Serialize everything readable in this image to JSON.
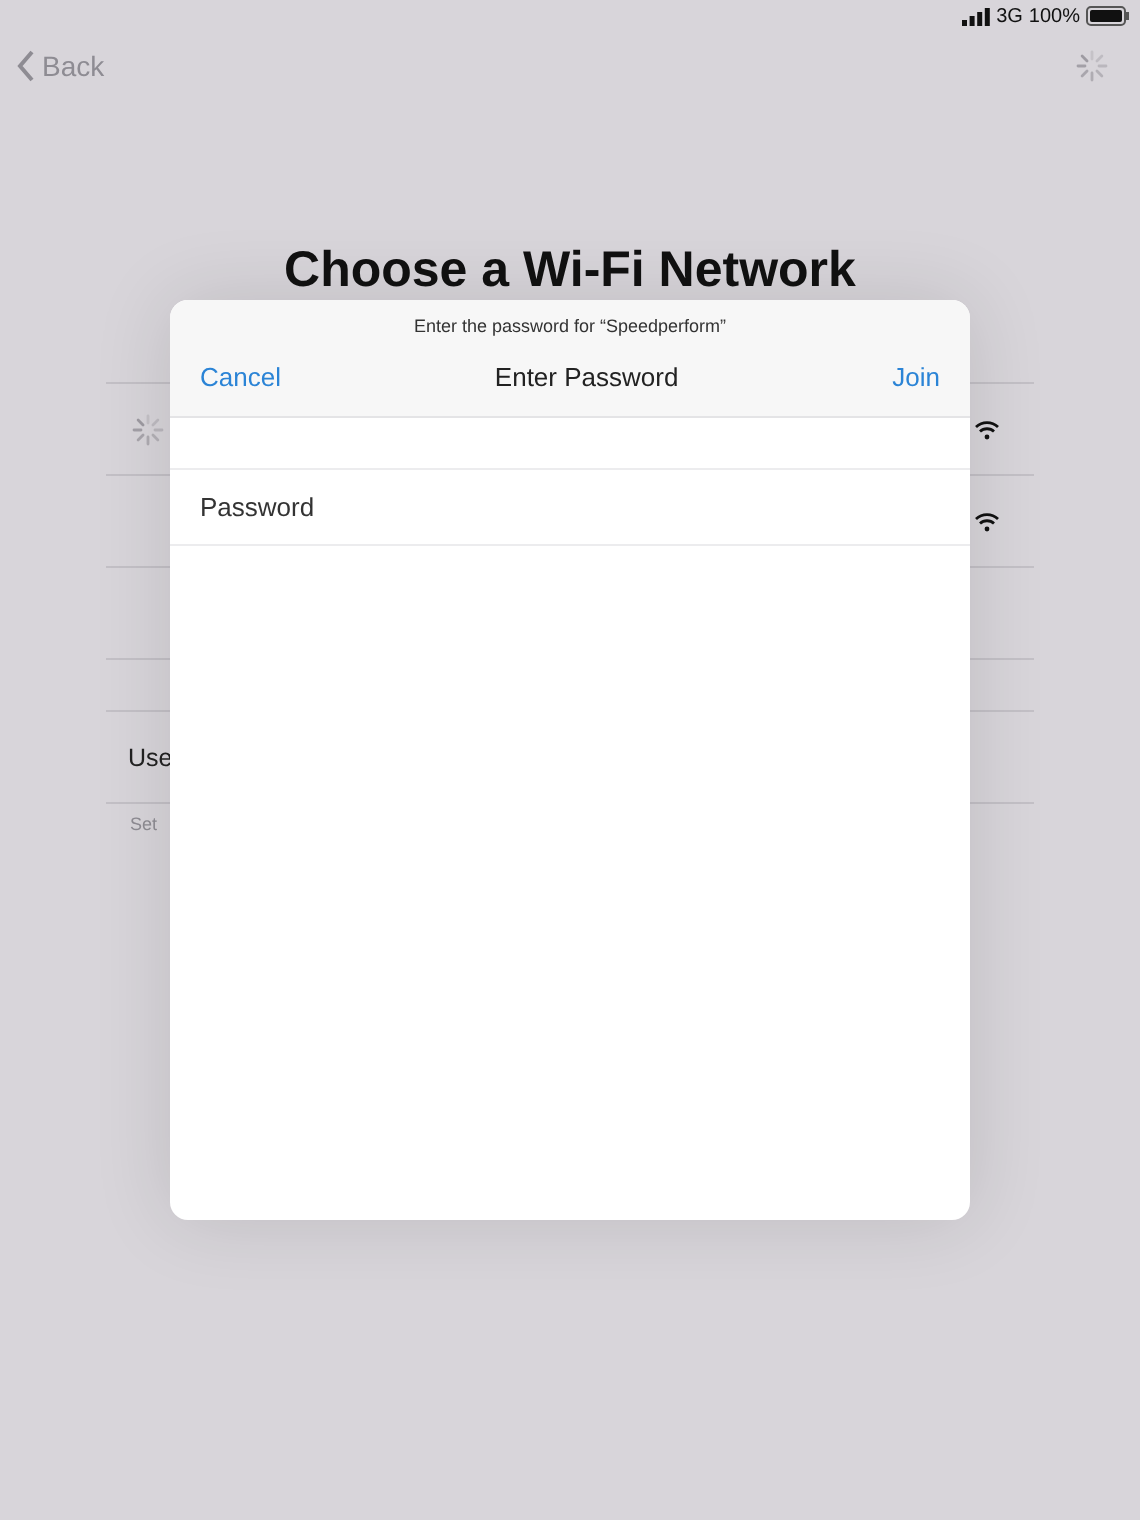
{
  "status_bar": {
    "network": "3G",
    "battery": "100%"
  },
  "nav": {
    "back": "Back"
  },
  "title": "Choose a Wi-Fi Network",
  "networks": [
    {
      "connecting": true
    },
    {
      "connecting": false
    }
  ],
  "other_section": {
    "label": "Use",
    "footnote": "Set"
  },
  "dialog": {
    "prompt": "Enter the password for “Speedperform”",
    "cancel": "Cancel",
    "title": "Enter Password",
    "join": "Join",
    "fields": [
      {
        "kind": "blank"
      },
      {
        "kind": "password",
        "label": "Password"
      }
    ]
  }
}
